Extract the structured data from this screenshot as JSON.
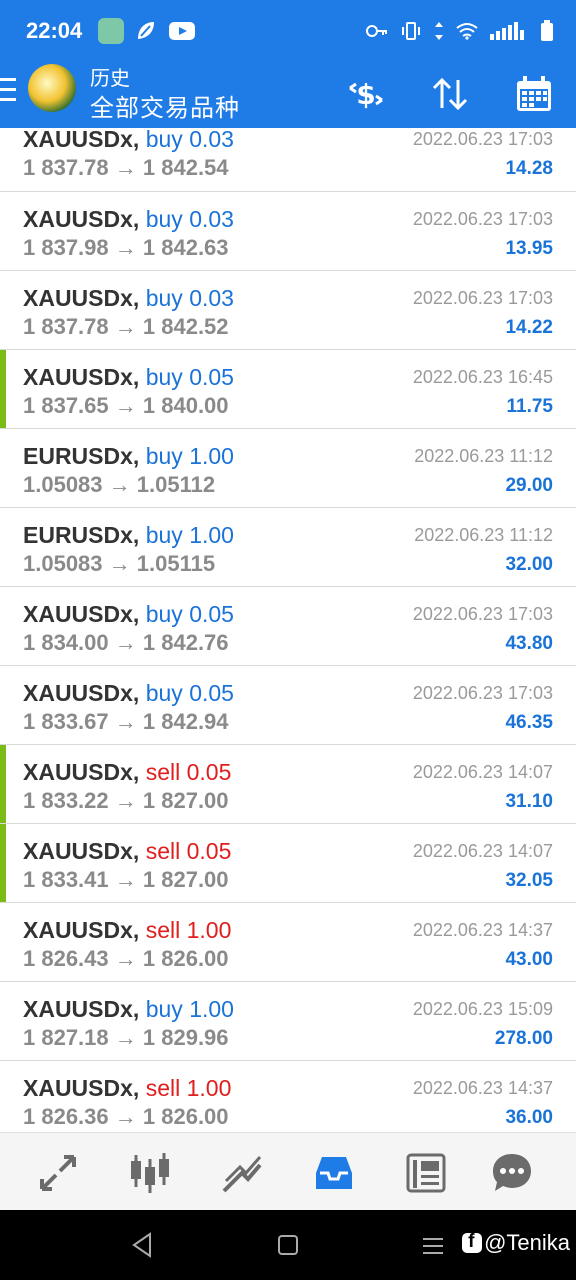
{
  "status_bar": {
    "time": "22:04"
  },
  "app_bar": {
    "title": "历史",
    "subtitle": "全部交易品种"
  },
  "trades": [
    {
      "symbol": "XAUUSDx,",
      "type": "buy",
      "volume": "0.03",
      "open": "1 837.78",
      "close": "1 842.54",
      "date": "2022.06.23 17:03",
      "profit": "14.28",
      "marker": false
    },
    {
      "symbol": "XAUUSDx,",
      "type": "buy",
      "volume": "0.03",
      "open": "1 837.98",
      "close": "1 842.63",
      "date": "2022.06.23 17:03",
      "profit": "13.95",
      "marker": false
    },
    {
      "symbol": "XAUUSDx,",
      "type": "buy",
      "volume": "0.03",
      "open": "1 837.78",
      "close": "1 842.52",
      "date": "2022.06.23 17:03",
      "profit": "14.22",
      "marker": false
    },
    {
      "symbol": "XAUUSDx,",
      "type": "buy",
      "volume": "0.05",
      "open": "1 837.65",
      "close": "1 840.00",
      "date": "2022.06.23 16:45",
      "profit": "11.75",
      "marker": true
    },
    {
      "symbol": "EURUSDx,",
      "type": "buy",
      "volume": "1.00",
      "open": "1.05083",
      "close": "1.05112",
      "date": "2022.06.23 11:12",
      "profit": "29.00",
      "marker": false
    },
    {
      "symbol": "EURUSDx,",
      "type": "buy",
      "volume": "1.00",
      "open": "1.05083",
      "close": "1.05115",
      "date": "2022.06.23 11:12",
      "profit": "32.00",
      "marker": false
    },
    {
      "symbol": "XAUUSDx,",
      "type": "buy",
      "volume": "0.05",
      "open": "1 834.00",
      "close": "1 842.76",
      "date": "2022.06.23 17:03",
      "profit": "43.80",
      "marker": false
    },
    {
      "symbol": "XAUUSDx,",
      "type": "buy",
      "volume": "0.05",
      "open": "1 833.67",
      "close": "1 842.94",
      "date": "2022.06.23 17:03",
      "profit": "46.35",
      "marker": false
    },
    {
      "symbol": "XAUUSDx,",
      "type": "sell",
      "volume": "0.05",
      "open": "1 833.22",
      "close": "1 827.00",
      "date": "2022.06.23 14:07",
      "profit": "31.10",
      "marker": true
    },
    {
      "symbol": "XAUUSDx,",
      "type": "sell",
      "volume": "0.05",
      "open": "1 833.41",
      "close": "1 827.00",
      "date": "2022.06.23 14:07",
      "profit": "32.05",
      "marker": true
    },
    {
      "symbol": "XAUUSDx,",
      "type": "sell",
      "volume": "1.00",
      "open": "1 826.43",
      "close": "1 826.00",
      "date": "2022.06.23 14:37",
      "profit": "43.00",
      "marker": false
    },
    {
      "symbol": "XAUUSDx,",
      "type": "buy",
      "volume": "1.00",
      "open": "1 827.18",
      "close": "1 829.96",
      "date": "2022.06.23 15:09",
      "profit": "278.00",
      "marker": false
    },
    {
      "symbol": "XAUUSDx,",
      "type": "sell",
      "volume": "1.00",
      "open": "1 826.36",
      "close": "1 826.00",
      "date": "2022.06.23 14:37",
      "profit": "36.00",
      "marker": false
    }
  ],
  "arrow": "→",
  "tabs": [
    {
      "name": "tab-quotes",
      "icon": "quotes-arrows-icon",
      "active": false
    },
    {
      "name": "tab-chart",
      "icon": "candlestick-icon",
      "active": false
    },
    {
      "name": "tab-trade",
      "icon": "trend-line-icon",
      "active": false
    },
    {
      "name": "tab-history",
      "icon": "inbox-tray-icon",
      "active": true
    },
    {
      "name": "tab-news",
      "icon": "newspaper-icon",
      "active": false
    },
    {
      "name": "tab-chat",
      "icon": "chat-bubble-icon",
      "active": false
    }
  ],
  "watermark": "@Tenika",
  "colors": {
    "accent": "#1f7be6",
    "buy": "#1a73d8",
    "sell": "#e01e1e",
    "marker": "#7bbb16",
    "profit": "#1a73d8"
  }
}
